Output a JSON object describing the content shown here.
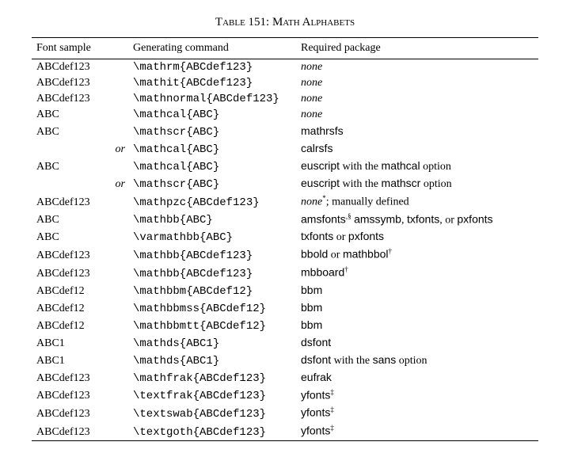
{
  "caption": "Table 151: Math Alphabets",
  "headers": {
    "c1": "Font sample",
    "c2": "Generating command",
    "c3": "Required package"
  },
  "or": "or",
  "rows": [
    {
      "s": "ABCdef123",
      "cmd": "\\mathrm{ABCdef123}",
      "pkg_it": "none",
      "pkg": ""
    },
    {
      "s": "ABCdef123",
      "cmd": "\\mathit{ABCdef123}",
      "pkg_it": "none",
      "pkg": ""
    },
    {
      "s": "ABCdef123",
      "cmd": "\\mathnormal{ABCdef123}",
      "pkg_it": "none",
      "pkg": ""
    },
    {
      "s": "ABC",
      "cmd": "\\mathcal{ABC}",
      "pkg_it": "none",
      "pkg": ""
    },
    {
      "s": "ABC",
      "cmd": "\\mathscr{ABC}",
      "pkg_sf": "mathrsfs"
    },
    {
      "or": true,
      "cmd": "\\mathcal{ABC}",
      "pkg_sf": "calrsfs"
    },
    {
      "s": "ABC",
      "cmd": "\\mathcal{ABC}",
      "pkg_sf": "euscript",
      "pkg_tail": " with the ",
      "pkg_sf2": "mathcal",
      "pkg_tail2": " option"
    },
    {
      "or": true,
      "cmd": "\\mathscr{ABC}",
      "pkg_sf": "euscript",
      "pkg_tail": " with the ",
      "pkg_sf2": "mathscr",
      "pkg_tail2": " option"
    },
    {
      "s": "ABCdef123",
      "cmd": "\\mathpzc{ABCdef123}",
      "pkg_it": "none",
      "pkg": "; manually defined",
      "sup": "*"
    },
    {
      "s": "ABC",
      "cmd": "\\mathbb{ABC}",
      "pkg_sf": "amsfonts",
      "sup": ",§",
      "pkg_tail": " ",
      "pkg_sf2": "amssymb",
      "pkg_tail2": ", ",
      "pkg_sf3": "txfonts",
      "pkg_tail3": ", or ",
      "pkg_sf4": "pxfonts"
    },
    {
      "s": "ABC",
      "cmd": "\\varmathbb{ABC}",
      "pkg_sf": "txfonts",
      "pkg_tail": " or ",
      "pkg_sf2": "pxfonts"
    },
    {
      "s": "ABCdef123",
      "cmd": "\\mathbb{ABCdef123}",
      "pkg_sf": "bbold",
      "pkg_tail": " or ",
      "pkg_sf2": "mathbbol",
      "sup2": "†"
    },
    {
      "s": "ABCdef123",
      "cmd": "\\mathbb{ABCdef123}",
      "pkg_sf": "mbboard",
      "sup": "†"
    },
    {
      "s": "ABCdef12",
      "cmd": "\\mathbbm{ABCdef12}",
      "pkg_sf": "bbm"
    },
    {
      "s": "ABCdef12",
      "cmd": "\\mathbbmss{ABCdef12}",
      "pkg_sf": "bbm"
    },
    {
      "s": "ABCdef12",
      "cmd": "\\mathbbmtt{ABCdef12}",
      "pkg_sf": "bbm"
    },
    {
      "s": "ABC1",
      "cmd": "\\mathds{ABC1}",
      "pkg_sf": "dsfont"
    },
    {
      "s": "ABC1",
      "cmd": "\\mathds{ABC1}",
      "pkg_sf": "dsfont",
      "pkg_tail": " with the ",
      "pkg_sf2": "sans",
      "pkg_tail2": " option"
    },
    {
      "s": "ABCdef123",
      "cmd": "\\mathfrak{ABCdef123}",
      "pkg_sf": "eufrak"
    },
    {
      "s": "ABCdef123",
      "cmd": "\\textfrak{ABCdef123}",
      "pkg_sf": "yfonts",
      "sup": "‡"
    },
    {
      "s": "ABCdef123",
      "cmd": "\\textswab{ABCdef123}",
      "pkg_sf": "yfonts",
      "sup": "‡"
    },
    {
      "s": "ABCdef123",
      "cmd": "\\textgoth{ABCdef123}",
      "pkg_sf": "yfonts",
      "sup": "‡"
    }
  ]
}
